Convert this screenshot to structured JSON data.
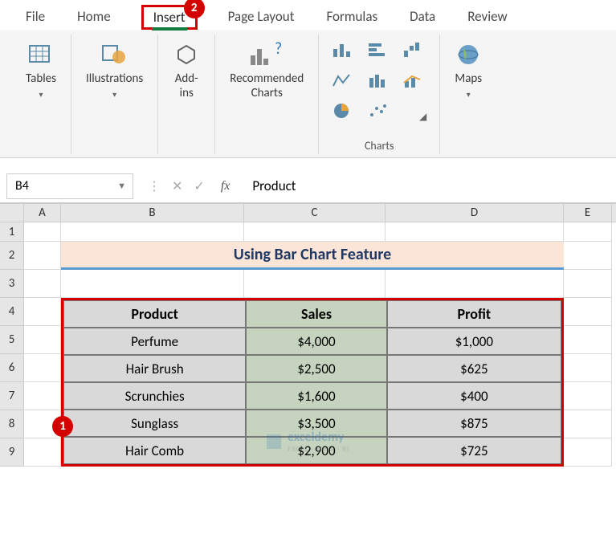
{
  "tabs": {
    "file": "File",
    "home": "Home",
    "insert": "Insert",
    "page_layout": "Page Layout",
    "formulas": "Formulas",
    "data": "Data",
    "review": "Review"
  },
  "ribbon": {
    "tables": "Tables",
    "illustrations": "Illustrations",
    "addins": "Add-\nins",
    "rec_charts": "Recommended\nCharts",
    "charts_group": "Charts",
    "maps": "Maps"
  },
  "badges": {
    "one": "1",
    "two": "2"
  },
  "formula": {
    "namebox": "B4",
    "fx": "fx",
    "value": "Product"
  },
  "columns": {
    "A": "A",
    "B": "B",
    "C": "C",
    "D": "D",
    "E": "E"
  },
  "rownums": [
    "1",
    "2",
    "3",
    "4",
    "5",
    "6",
    "7",
    "8",
    "9"
  ],
  "title_banner": "Using Bar Chart Feature",
  "table": {
    "headers": {
      "product": "Product",
      "sales": "Sales",
      "profit": "Profit"
    },
    "rows": [
      {
        "product": "Perfume",
        "sales": "$4,000",
        "profit": "$1,000"
      },
      {
        "product": "Hair Brush",
        "sales": "$2,500",
        "profit": "$625"
      },
      {
        "product": "Scrunchies",
        "sales": "$1,600",
        "profit": "$400"
      },
      {
        "product": "Sunglass",
        "sales": "$3,500",
        "profit": "$875"
      },
      {
        "product": "Hair Comb",
        "sales": "$2,900",
        "profit": "$725"
      }
    ]
  },
  "watermark": {
    "brand": "exceldemy",
    "tag": "EXCEL · DATA · BI"
  }
}
